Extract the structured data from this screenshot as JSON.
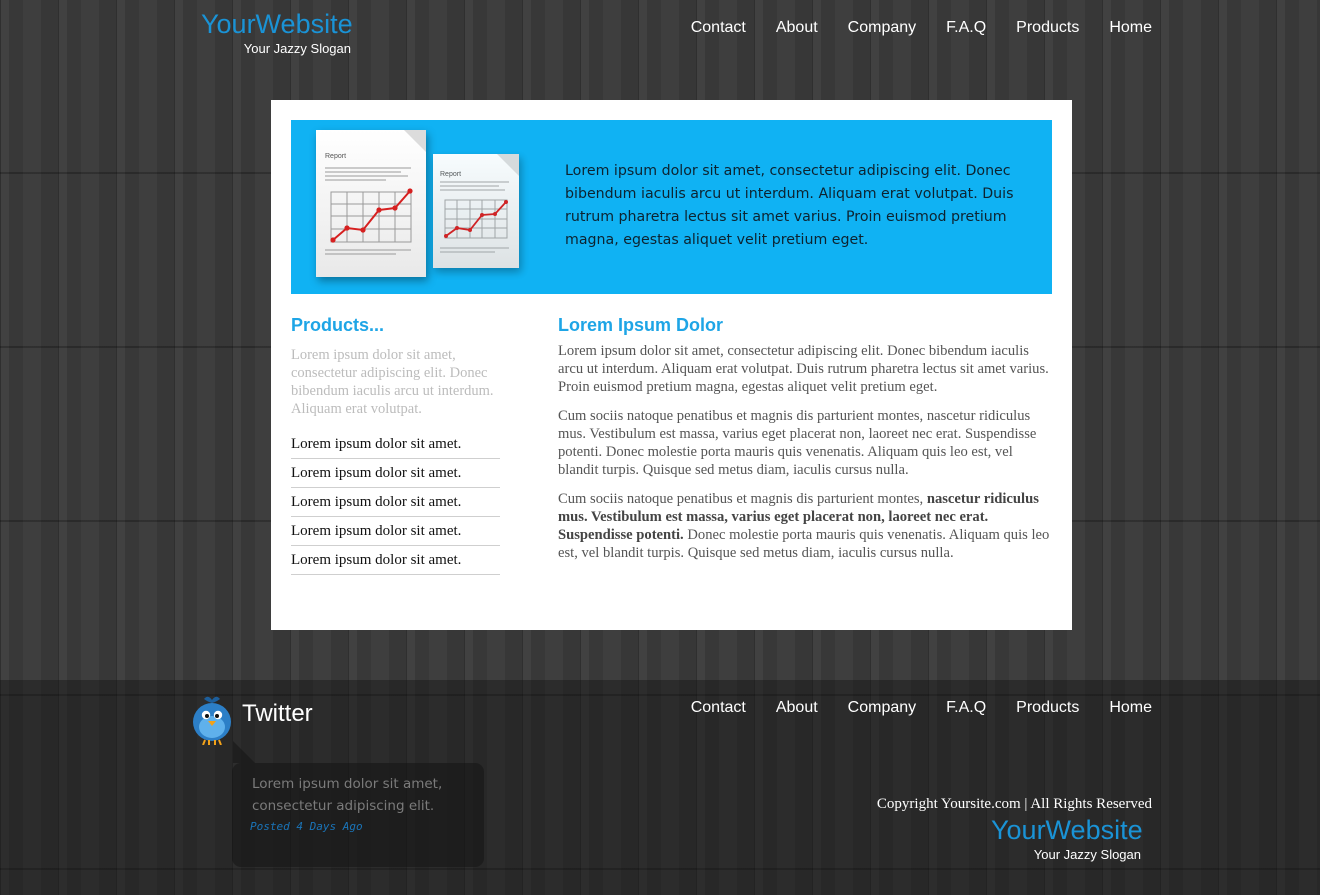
{
  "header": {
    "logo_title": "YourWebsite",
    "logo_slogan": "Your Jazzy Slogan",
    "nav": [
      "Contact",
      "About",
      "Company",
      "F.A.Q",
      "Products",
      "Home"
    ]
  },
  "banner": {
    "report_label_1": "Report",
    "report_label_2": "Report",
    "text": "Lorem ipsum dolor sit amet, consectetur adipiscing elit. Donec bibendum iaculis arcu ut interdum. Aliquam erat volutpat. Duis rutrum pharetra lectus sit amet varius. Proin euismod pretium magna, egestas aliquet velit pretium eget."
  },
  "products": {
    "heading": "Products...",
    "intro": "Lorem ipsum dolor sit amet, consectetur adipiscing elit. Donec bibendum iaculis arcu ut interdum. Aliquam erat volutpat.",
    "items": [
      "Lorem ipsum dolor sit amet.",
      "Lorem ipsum dolor sit amet.",
      "Lorem ipsum dolor sit amet.",
      "Lorem ipsum dolor sit amet.",
      "Lorem ipsum dolor sit amet."
    ]
  },
  "article": {
    "heading": "Lorem Ipsum Dolor",
    "p1": "Lorem ipsum dolor sit amet, consectetur adipiscing elit. Donec bibendum iaculis arcu ut interdum. Aliquam erat volutpat. Duis rutrum pharetra lectus sit amet varius. Proin euismod pretium magna, egestas aliquet velit pretium eget.",
    "p2": "Cum sociis natoque penatibus et magnis dis parturient montes, nascetur ridiculus mus. Vestibulum est massa, varius eget placerat non, laoreet nec erat. Suspendisse potenti. Donec molestie porta mauris quis venenatis. Aliquam quis leo est, vel blandit turpis. Quisque sed metus diam, iaculis cursus nulla.",
    "p3_start": "Cum sociis natoque penatibus et magnis dis parturient montes, ",
    "p3_bold": "nascetur ridiculus mus. Vestibulum est massa, varius eget placerat non, laoreet nec erat. Suspendisse potenti.",
    "p3_end": " Donec molestie porta mauris quis venenatis. Aliquam quis leo est, vel blandit turpis. Quisque sed metus diam, iaculis cursus nulla."
  },
  "footer": {
    "twitter_title": "Twitter",
    "tweet_text": "Lorem ipsum dolor sit amet, consectetur adipiscing elit.",
    "tweet_meta": "Posted 4 Days Ago",
    "nav": [
      "Contact",
      "About",
      "Company",
      "F.A.Q",
      "Products",
      "Home"
    ],
    "copyright": "Copyright Yoursite.com | All Rights Reserved",
    "logo_title": "YourWebsite",
    "logo_slogan": "Your Jazzy Slogan"
  },
  "colors": {
    "accent": "#1a93d6",
    "banner": "#10b2f3",
    "background": "#3a3a3a"
  }
}
